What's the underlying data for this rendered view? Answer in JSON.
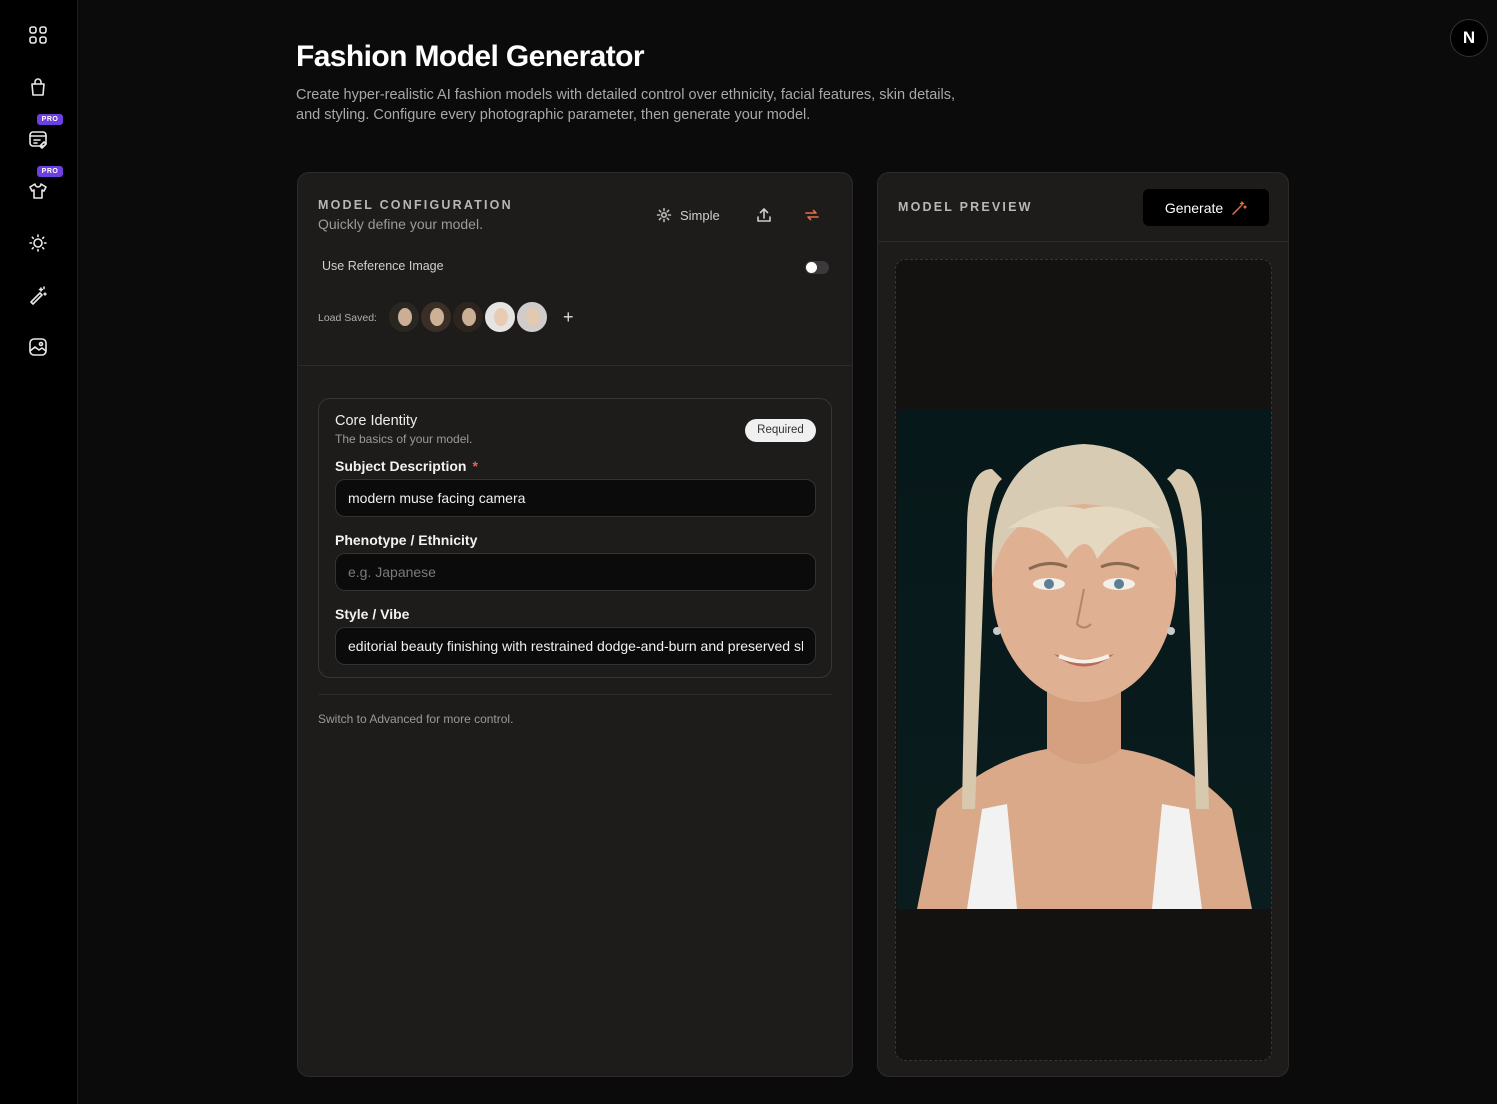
{
  "header": {
    "title": "Fashion Model Generator",
    "description": "Create hyper-realistic AI fashion models with detailed control over ethnicity, facial features, skin details, and styling. Configure every photographic parameter, then generate your model."
  },
  "sidebar": {
    "items": [
      {
        "icon": "grid-icon"
      },
      {
        "icon": "shopping-bag-icon"
      },
      {
        "icon": "browser-edit-icon",
        "badge": "PRO"
      },
      {
        "icon": "tshirt-icon",
        "badge": "PRO"
      },
      {
        "icon": "sun-icon"
      },
      {
        "icon": "magic-wand-icon"
      },
      {
        "icon": "image-icon"
      }
    ]
  },
  "user": {
    "initial": "N"
  },
  "config": {
    "label": "MODEL CONFIGURATION",
    "subtitle": "Quickly define your model.",
    "mode_label": "Simple",
    "reference_label": "Use Reference Image",
    "reference_enabled": false,
    "load_saved_label": "Load Saved:",
    "saved_count": 5,
    "add_label": "+",
    "core": {
      "title": "Core Identity",
      "subtitle": "The basics of your model.",
      "badge": "Required",
      "subject_label": "Subject Description",
      "subject_required": "*",
      "subject_value": "modern muse facing camera",
      "phenotype_label": "Phenotype / Ethnicity",
      "phenotype_placeholder": "e.g. Japanese",
      "phenotype_value": "",
      "style_label": "Style / Vibe",
      "style_value": "editorial beauty finishing with restrained dodge-and-burn and preserved skin texture"
    },
    "advanced_note": "Switch to Advanced for more control."
  },
  "preview": {
    "label": "MODEL PREVIEW",
    "generate_label": "Generate"
  },
  "colors": {
    "accent": "#e0704a",
    "pro_badge": "#6d3fe0",
    "panel_bg": "#1e1b1b"
  }
}
